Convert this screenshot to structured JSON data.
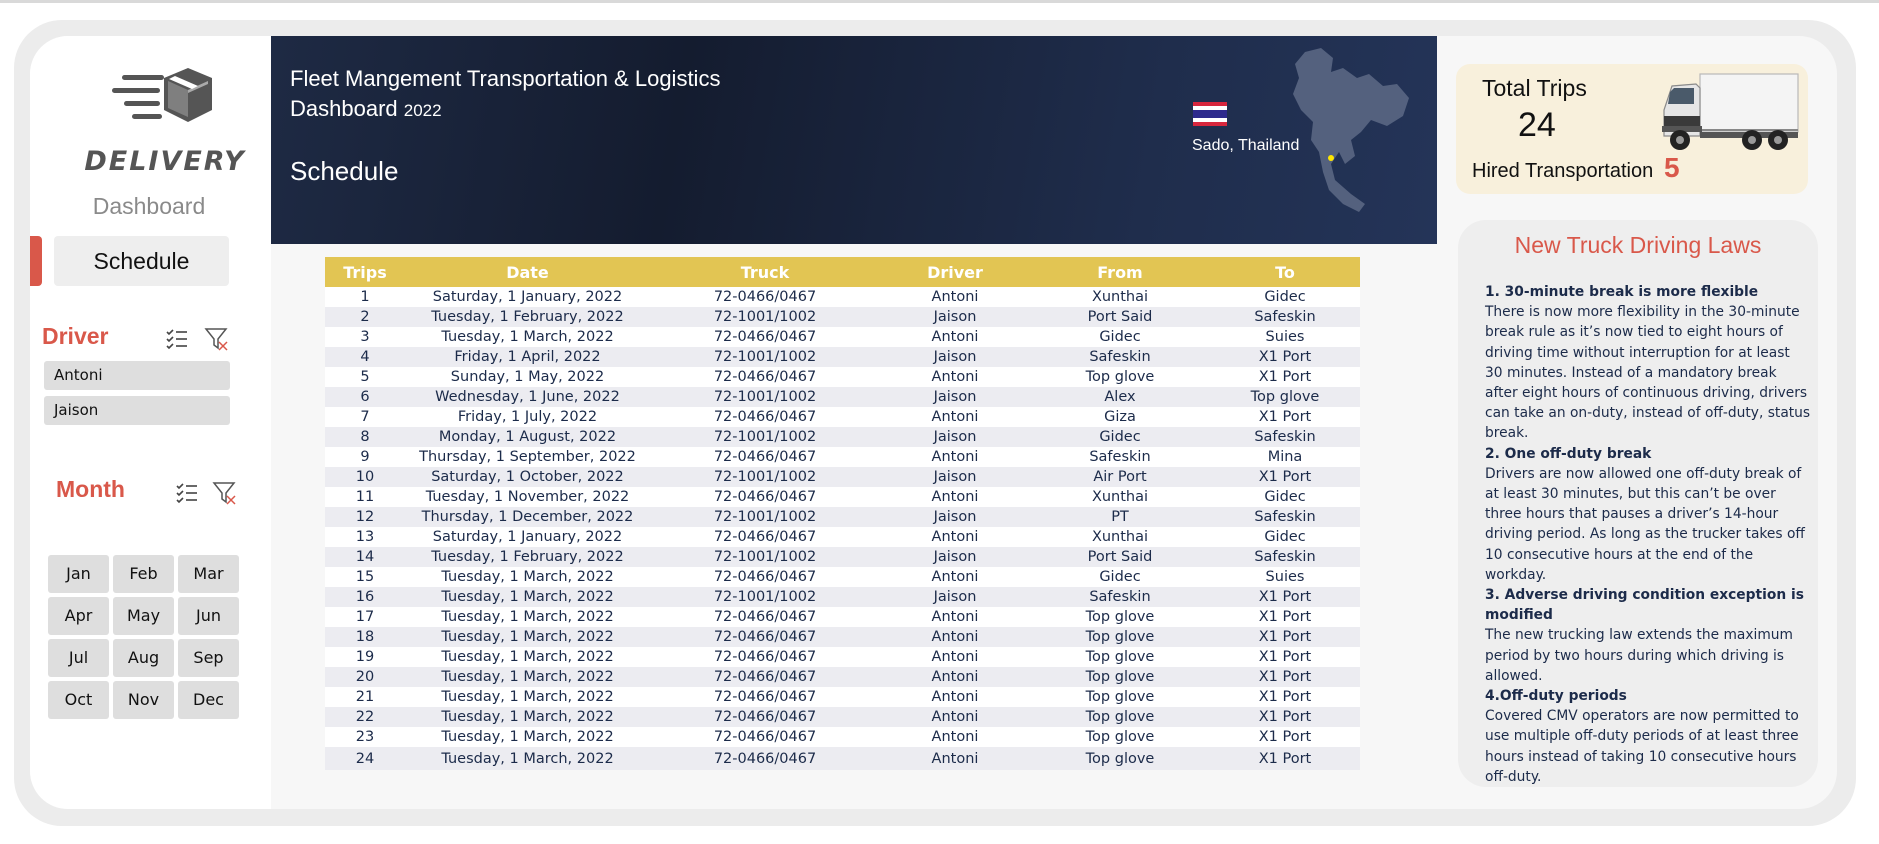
{
  "sidebar": {
    "logo_text": "DELIVERY",
    "nav": {
      "dashboard": "Dashboard",
      "schedule": "Schedule"
    },
    "driver_slicer": {
      "title": "Driver",
      "items": [
        "Antoni",
        "Jaison"
      ]
    },
    "month_slicer": {
      "title": "Month",
      "items": [
        "Jan",
        "Feb",
        "Mar",
        "Apr",
        "May",
        "Jun",
        "Jul",
        "Aug",
        "Sep",
        "Oct",
        "Nov",
        "Dec"
      ]
    }
  },
  "header": {
    "title": "Fleet Mangement Transportation & Logistics",
    "subtitle": "Dashboard",
    "year": "2022",
    "section": "Schedule",
    "location": "Sado, Thailand"
  },
  "table": {
    "columns": [
      "Trips",
      "Date",
      "Truck",
      "Driver",
      "From",
      "To"
    ],
    "rows": [
      [
        "1",
        "Saturday, 1 January, 2022",
        "72-0466/0467",
        "Antoni",
        "Xunthai",
        "Gidec"
      ],
      [
        "2",
        "Tuesday, 1 February, 2022",
        "72-1001/1002",
        "Jaison",
        "Port Said",
        "Safeskin"
      ],
      [
        "3",
        "Tuesday, 1 March, 2022",
        "72-0466/0467",
        "Antoni",
        "Gidec",
        "Suies"
      ],
      [
        "4",
        "Friday, 1 April, 2022",
        "72-1001/1002",
        "Jaison",
        "Safeskin",
        "X1 Port"
      ],
      [
        "5",
        "Sunday, 1 May, 2022",
        "72-0466/0467",
        "Antoni",
        "Top glove",
        "X1 Port"
      ],
      [
        "6",
        "Wednesday, 1 June, 2022",
        "72-1001/1002",
        "Jaison",
        "Alex",
        "Top glove"
      ],
      [
        "7",
        "Friday, 1 July, 2022",
        "72-0466/0467",
        "Antoni",
        "Giza",
        "X1 Port"
      ],
      [
        "8",
        "Monday, 1 August, 2022",
        "72-1001/1002",
        "Jaison",
        "Gidec",
        "Safeskin"
      ],
      [
        "9",
        "Thursday, 1 September, 2022",
        "72-0466/0467",
        "Antoni",
        "Safeskin",
        "Mina"
      ],
      [
        "10",
        "Saturday, 1 October, 2022",
        "72-1001/1002",
        "Jaison",
        "Air Port",
        "X1 Port"
      ],
      [
        "11",
        "Tuesday, 1 November, 2022",
        "72-0466/0467",
        "Antoni",
        "Xunthai",
        "Gidec"
      ],
      [
        "12",
        "Thursday, 1 December, 2022",
        "72-1001/1002",
        "Jaison",
        "PT",
        "Safeskin"
      ],
      [
        "13",
        "Saturday, 1 January, 2022",
        "72-0466/0467",
        "Antoni",
        "Xunthai",
        "Gidec"
      ],
      [
        "14",
        "Tuesday, 1 February, 2022",
        "72-1001/1002",
        "Jaison",
        "Port Said",
        "Safeskin"
      ],
      [
        "15",
        "Tuesday, 1 March, 2022",
        "72-0466/0467",
        "Antoni",
        "Gidec",
        "Suies"
      ],
      [
        "16",
        "Tuesday, 1 March, 2022",
        "72-1001/1002",
        "Jaison",
        "Safeskin",
        "X1 Port"
      ],
      [
        "17",
        "Tuesday, 1 March, 2022",
        "72-0466/0467",
        "Antoni",
        "Top glove",
        "X1 Port"
      ],
      [
        "18",
        "Tuesday, 1 March, 2022",
        "72-0466/0467",
        "Antoni",
        "Top glove",
        "X1 Port"
      ],
      [
        "19",
        "Tuesday, 1 March, 2022",
        "72-0466/0467",
        "Antoni",
        "Top glove",
        "X1 Port"
      ],
      [
        "20",
        "Tuesday, 1 March, 2022",
        "72-0466/0467",
        "Antoni",
        "Top glove",
        "X1 Port"
      ],
      [
        "21",
        "Tuesday, 1 March, 2022",
        "72-0466/0467",
        "Antoni",
        "Top glove",
        "X1 Port"
      ],
      [
        "22",
        "Tuesday, 1 March, 2022",
        "72-0466/0467",
        "Antoni",
        "Top glove",
        "X1 Port"
      ],
      [
        "23",
        "Tuesday, 1 March, 2022",
        "72-0466/0467",
        "Antoni",
        "Top glove",
        "X1 Port"
      ],
      [
        "24",
        "Tuesday, 1 March, 2022",
        "72-0466/0467",
        "Antoni",
        "Top glove",
        "X1 Port"
      ]
    ]
  },
  "stats": {
    "total_trips_label": "Total Trips",
    "total_trips_value": "24",
    "hired_label": "Hired Transportation",
    "hired_value": "5"
  },
  "laws": {
    "title": "New Truck Driving Laws",
    "items": [
      {
        "heading": "1. 30-minute break is more flexible",
        "text": "There is now more flexibility in the 30-minute break rule as it’s now tied to eight hours of driving time without interruption for at least 30 minutes. Instead of a mandatory break after eight hours of continuous driving, drivers can take an on-duty, instead of off-duty, status break."
      },
      {
        "heading": "2. One off-duty break",
        "text": "Drivers are now allowed one off-duty break of at least 30 minutes, but this can’t be over three hours that pauses a driver’s 14-hour driving period. As long as the trucker takes off 10 consecutive hours at the end of the workday."
      },
      {
        "heading": "3. Adverse driving condition exception is modified",
        "text": "The new trucking law extends the maximum period by two hours during which driving is allowed."
      },
      {
        "heading": "4.Off-duty periods",
        "text": "Covered CMV operators are now permitted to use multiple off-duty periods of at least three hours instead of taking 10 consecutive hours off-duty."
      }
    ]
  },
  "colors": {
    "accent": "#d9584a",
    "header_bg": "#1a2440",
    "table_header": "#e2c553",
    "table_text": "#1c2b4a",
    "card_bg": "#f8f0dc"
  }
}
